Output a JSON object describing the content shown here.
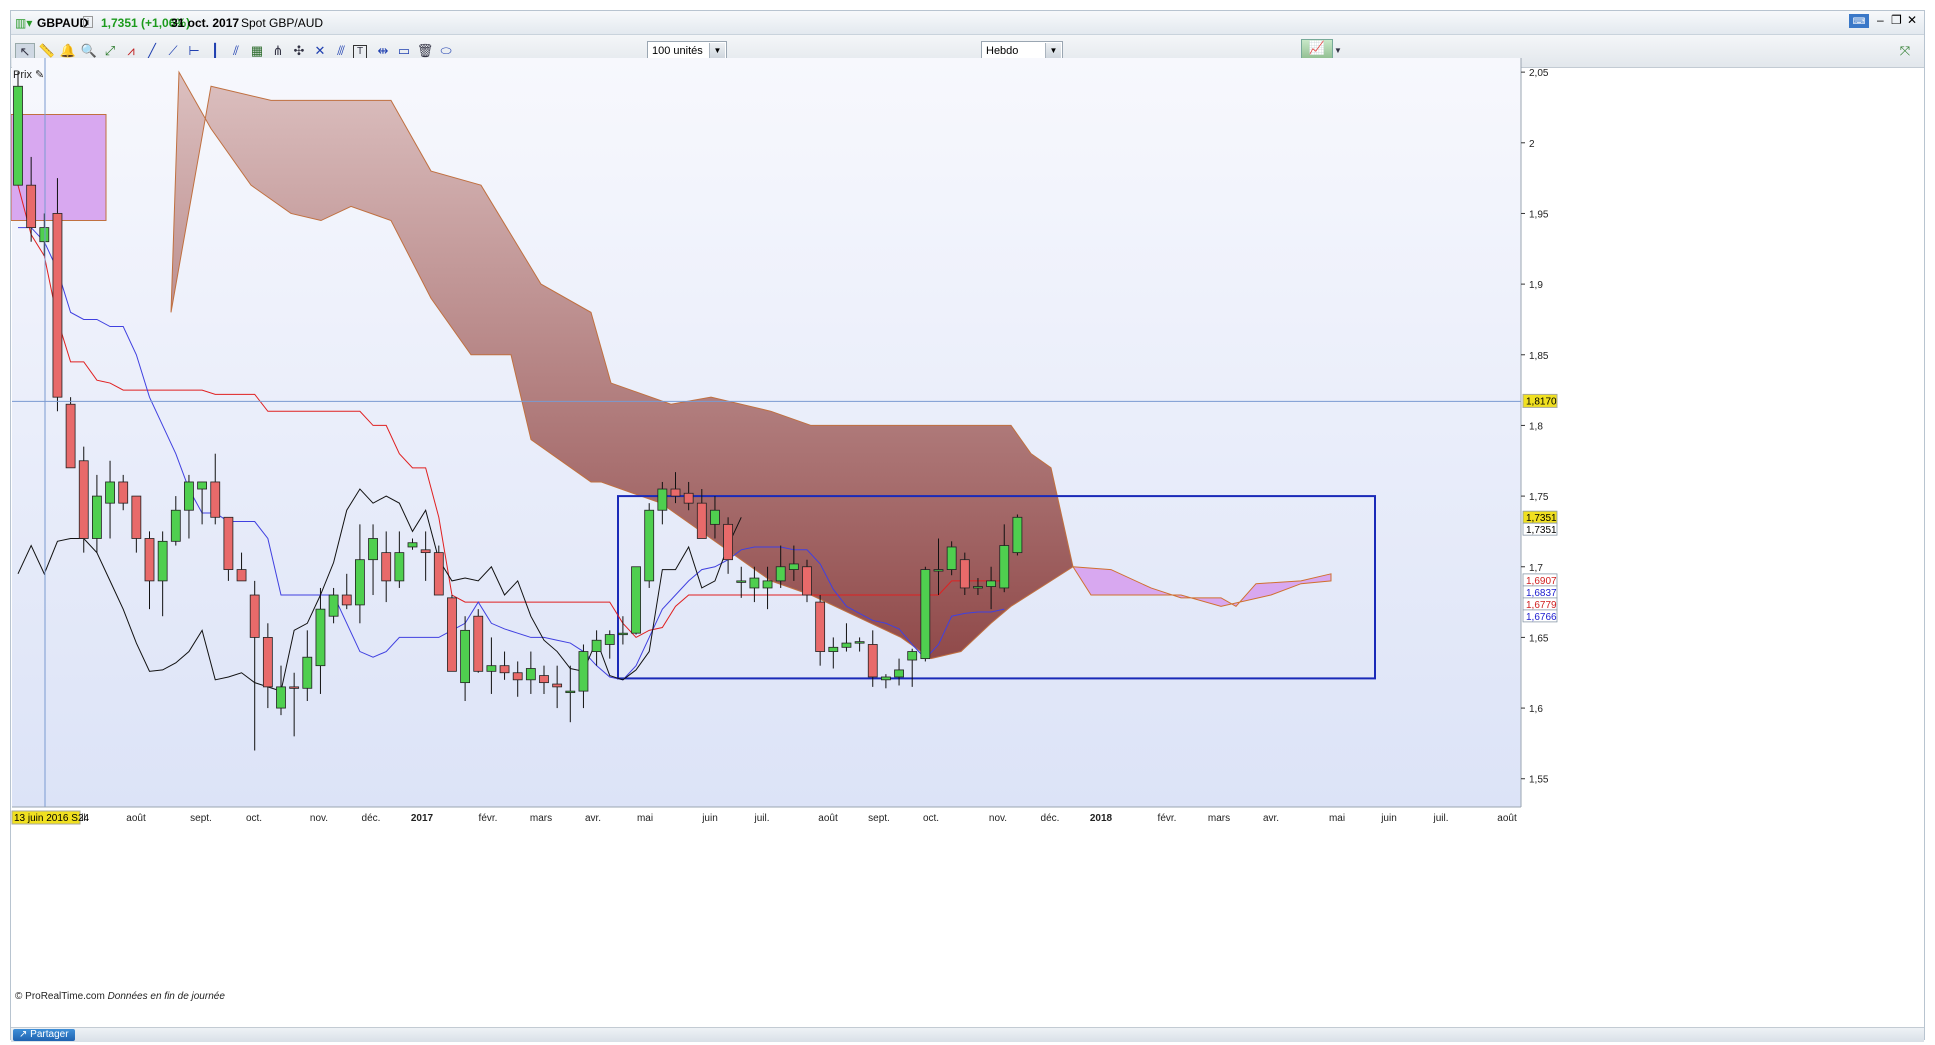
{
  "header": {
    "symbol": "GBPAUD",
    "quote": "1,7351 (+1,06%)",
    "date": "31 oct. 2017",
    "instrument": "Spot GBP/AUD"
  },
  "toolbar": {
    "units_select": "100 unités",
    "period_select": "Hebdo"
  },
  "chart_labels": {
    "price_label": "Prix",
    "copyright": "© ProRealTime.com",
    "data_note": "Données en fin de journée",
    "crosshair_date": "13 juin 2016 S24",
    "crosshair_price": "1,8170",
    "share_button": "Partager"
  },
  "colors": {
    "bull_candle": "#4fcf4f",
    "bear_candle": "#e86a6a",
    "kijun": "#e02020",
    "tenkan": "#4040e0",
    "chikou": "#111111",
    "cloud_bear": "#9a5a5a",
    "cloud_bull": "#d8a8f0",
    "box": "#1a2ab8"
  },
  "chart_data": {
    "type": "candlestick",
    "title": "GBPAUD hebdo",
    "ylim": [
      1.53,
      2.06
    ],
    "y_ticks": [
      "2,05",
      "2",
      "1,95",
      "1,9",
      "1,85",
      "1,8",
      "1,75",
      "1,7",
      "1,65",
      "1,6",
      "1,55"
    ],
    "y_tick_values": [
      2.05,
      2.0,
      1.95,
      1.9,
      1.85,
      1.8,
      1.75,
      1.7,
      1.65,
      1.6,
      1.55
    ],
    "x_labels": [
      "juil.",
      "août",
      "sept.",
      "oct.",
      "nov.",
      "déc.",
      "2017",
      "févr.",
      "mars",
      "avr.",
      "mai",
      "juin",
      "juil.",
      "août",
      "sept.",
      "oct.",
      "nov.",
      "déc.",
      "2018",
      "févr.",
      "mars",
      "avr.",
      "mai",
      "juin",
      "juil.",
      "août"
    ],
    "price_badges": [
      {
        "value": "1,7351",
        "color": "#f0e020"
      },
      {
        "value": "1,7351",
        "color": "#ffffff"
      },
      {
        "value": "1,6907",
        "color": "#ffffff"
      },
      {
        "value": "1,6837",
        "color": "#ffffff"
      },
      {
        "value": "1,6779",
        "color": "#ffffff"
      },
      {
        "value": "1,6766",
        "color": "#ffffff"
      }
    ],
    "candles": [
      {
        "o": 1.97,
        "h": 2.05,
        "l": 1.97,
        "c": 2.04
      },
      {
        "o": 1.97,
        "h": 1.99,
        "l": 1.93,
        "c": 1.94
      },
      {
        "o": 1.93,
        "h": 1.95,
        "l": 1.92,
        "c": 1.94
      },
      {
        "o": 1.95,
        "h": 1.975,
        "l": 1.81,
        "c": 1.82
      },
      {
        "o": 1.815,
        "h": 1.82,
        "l": 1.77,
        "c": 1.77
      },
      {
        "o": 1.775,
        "h": 1.785,
        "l": 1.71,
        "c": 1.72
      },
      {
        "o": 1.72,
        "h": 1.765,
        "l": 1.71,
        "c": 1.75
      },
      {
        "o": 1.745,
        "h": 1.775,
        "l": 1.72,
        "c": 1.76
      },
      {
        "o": 1.76,
        "h": 1.765,
        "l": 1.74,
        "c": 1.745
      },
      {
        "o": 1.75,
        "h": 1.75,
        "l": 1.71,
        "c": 1.72
      },
      {
        "o": 1.72,
        "h": 1.725,
        "l": 1.67,
        "c": 1.69
      },
      {
        "o": 1.69,
        "h": 1.725,
        "l": 1.665,
        "c": 1.718
      },
      {
        "o": 1.718,
        "h": 1.75,
        "l": 1.715,
        "c": 1.74
      },
      {
        "o": 1.74,
        "h": 1.765,
        "l": 1.72,
        "c": 1.76
      },
      {
        "o": 1.755,
        "h": 1.76,
        "l": 1.73,
        "c": 1.76
      },
      {
        "o": 1.76,
        "h": 1.78,
        "l": 1.73,
        "c": 1.735
      },
      {
        "o": 1.735,
        "h": 1.735,
        "l": 1.69,
        "c": 1.698
      },
      {
        "o": 1.698,
        "h": 1.71,
        "l": 1.69,
        "c": 1.69
      },
      {
        "o": 1.68,
        "h": 1.69,
        "l": 1.57,
        "c": 1.65
      },
      {
        "o": 1.65,
        "h": 1.66,
        "l": 1.6,
        "c": 1.615
      },
      {
        "o": 1.6,
        "h": 1.63,
        "l": 1.595,
        "c": 1.615
      },
      {
        "o": 1.615,
        "h": 1.625,
        "l": 1.58,
        "c": 1.614
      },
      {
        "o": 1.614,
        "h": 1.655,
        "l": 1.605,
        "c": 1.636
      },
      {
        "o": 1.63,
        "h": 1.685,
        "l": 1.61,
        "c": 1.67
      },
      {
        "o": 1.665,
        "h": 1.685,
        "l": 1.66,
        "c": 1.68
      },
      {
        "o": 1.68,
        "h": 1.695,
        "l": 1.67,
        "c": 1.673
      },
      {
        "o": 1.673,
        "h": 1.73,
        "l": 1.66,
        "c": 1.705
      },
      {
        "o": 1.705,
        "h": 1.73,
        "l": 1.68,
        "c": 1.72
      },
      {
        "o": 1.71,
        "h": 1.725,
        "l": 1.675,
        "c": 1.69
      },
      {
        "o": 1.69,
        "h": 1.725,
        "l": 1.685,
        "c": 1.71
      },
      {
        "o": 1.714,
        "h": 1.72,
        "l": 1.712,
        "c": 1.717
      },
      {
        "o": 1.712,
        "h": 1.725,
        "l": 1.69,
        "c": 1.71
      },
      {
        "o": 1.71,
        "h": 1.715,
        "l": 1.68,
        "c": 1.68
      },
      {
        "o": 1.678,
        "h": 1.68,
        "l": 1.63,
        "c": 1.626
      },
      {
        "o": 1.618,
        "h": 1.665,
        "l": 1.605,
        "c": 1.655
      },
      {
        "o": 1.665,
        "h": 1.67,
        "l": 1.625,
        "c": 1.626
      },
      {
        "o": 1.626,
        "h": 1.65,
        "l": 1.61,
        "c": 1.63
      },
      {
        "o": 1.63,
        "h": 1.64,
        "l": 1.62,
        "c": 1.625
      },
      {
        "o": 1.625,
        "h": 1.633,
        "l": 1.608,
        "c": 1.62
      },
      {
        "o": 1.62,
        "h": 1.64,
        "l": 1.61,
        "c": 1.628
      },
      {
        "o": 1.623,
        "h": 1.63,
        "l": 1.61,
        "c": 1.618
      },
      {
        "o": 1.617,
        "h": 1.63,
        "l": 1.6,
        "c": 1.615
      },
      {
        "o": 1.612,
        "h": 1.63,
        "l": 1.59,
        "c": 1.612
      },
      {
        "o": 1.612,
        "h": 1.645,
        "l": 1.6,
        "c": 1.64
      },
      {
        "o": 1.64,
        "h": 1.655,
        "l": 1.63,
        "c": 1.648
      },
      {
        "o": 1.645,
        "h": 1.655,
        "l": 1.635,
        "c": 1.652
      },
      {
        "o": 1.652,
        "h": 1.665,
        "l": 1.645,
        "c": 1.653
      },
      {
        "o": 1.653,
        "h": 1.7,
        "l": 1.652,
        "c": 1.7
      },
      {
        "o": 1.69,
        "h": 1.745,
        "l": 1.685,
        "c": 1.74
      },
      {
        "o": 1.74,
        "h": 1.76,
        "l": 1.73,
        "c": 1.755
      },
      {
        "o": 1.755,
        "h": 1.767,
        "l": 1.745,
        "c": 1.75
      },
      {
        "o": 1.752,
        "h": 1.76,
        "l": 1.74,
        "c": 1.745
      },
      {
        "o": 1.745,
        "h": 1.755,
        "l": 1.72,
        "c": 1.72
      },
      {
        "o": 1.73,
        "h": 1.75,
        "l": 1.72,
        "c": 1.74
      },
      {
        "o": 1.73,
        "h": 1.735,
        "l": 1.695,
        "c": 1.705
      },
      {
        "o": 1.69,
        "h": 1.7,
        "l": 1.678,
        "c": 1.69
      },
      {
        "o": 1.685,
        "h": 1.7,
        "l": 1.675,
        "c": 1.692
      },
      {
        "o": 1.685,
        "h": 1.7,
        "l": 1.67,
        "c": 1.69
      },
      {
        "o": 1.69,
        "h": 1.715,
        "l": 1.685,
        "c": 1.7
      },
      {
        "o": 1.698,
        "h": 1.715,
        "l": 1.69,
        "c": 1.702
      },
      {
        "o": 1.7,
        "h": 1.705,
        "l": 1.675,
        "c": 1.68
      },
      {
        "o": 1.675,
        "h": 1.68,
        "l": 1.63,
        "c": 1.64
      },
      {
        "o": 1.64,
        "h": 1.65,
        "l": 1.628,
        "c": 1.643
      },
      {
        "o": 1.643,
        "h": 1.66,
        "l": 1.64,
        "c": 1.646
      },
      {
        "o": 1.646,
        "h": 1.65,
        "l": 1.64,
        "c": 1.647
      },
      {
        "o": 1.645,
        "h": 1.655,
        "l": 1.615,
        "c": 1.622
      },
      {
        "o": 1.62,
        "h": 1.624,
        "l": 1.614,
        "c": 1.622
      },
      {
        "o": 1.622,
        "h": 1.635,
        "l": 1.616,
        "c": 1.627
      },
      {
        "o": 1.634,
        "h": 1.642,
        "l": 1.615,
        "c": 1.64
      },
      {
        "o": 1.635,
        "h": 1.7,
        "l": 1.633,
        "c": 1.698
      },
      {
        "o": 1.698,
        "h": 1.72,
        "l": 1.68,
        "c": 1.698
      },
      {
        "o": 1.698,
        "h": 1.718,
        "l": 1.694,
        "c": 1.714
      },
      {
        "o": 1.705,
        "h": 1.71,
        "l": 1.68,
        "c": 1.685
      },
      {
        "o": 1.685,
        "h": 1.692,
        "l": 1.68,
        "c": 1.686
      },
      {
        "o": 1.686,
        "h": 1.7,
        "l": 1.67,
        "c": 1.69
      },
      {
        "o": 1.685,
        "h": 1.73,
        "l": 1.682,
        "c": 1.715
      },
      {
        "o": 1.71,
        "h": 1.737,
        "l": 1.708,
        "c": 1.735
      }
    ],
    "kijun": [
      1.97,
      1.935,
      1.92,
      1.875,
      1.845,
      1.845,
      1.832,
      1.83,
      1.825,
      1.825,
      1.825,
      1.825,
      1.825,
      1.825,
      1.825,
      1.822,
      1.822,
      1.822,
      1.822,
      1.81,
      1.81,
      1.81,
      1.81,
      1.81,
      1.81,
      1.81,
      1.81,
      1.8,
      1.8,
      1.78,
      1.77,
      1.77,
      1.735,
      1.68,
      1.675,
      1.675,
      1.675,
      1.675,
      1.675,
      1.675,
      1.675,
      1.675,
      1.675,
      1.675,
      1.675,
      1.675,
      1.66,
      1.65,
      1.655,
      1.657,
      1.672,
      1.68,
      1.68,
      1.68,
      1.68,
      1.68,
      1.68,
      1.68,
      1.68,
      1.68,
      1.68,
      1.68,
      1.68,
      1.68,
      1.68,
      1.68,
      1.68,
      1.68,
      1.68,
      1.68,
      1.68,
      1.69,
      1.69,
      1.69,
      1.69,
      1.69
    ],
    "tenkan": [
      1.94,
      1.94,
      1.93,
      1.91,
      1.88,
      1.875,
      1.875,
      1.87,
      1.87,
      1.85,
      1.82,
      1.8,
      1.78,
      1.755,
      1.738,
      1.738,
      1.732,
      1.732,
      1.732,
      1.72,
      1.68,
      1.68,
      1.68,
      1.68,
      1.68,
      1.66,
      1.64,
      1.636,
      1.64,
      1.65,
      1.65,
      1.65,
      1.65,
      1.655,
      1.66,
      1.675,
      1.66,
      1.656,
      1.653,
      1.65,
      1.65,
      1.648,
      1.646,
      1.64,
      1.63,
      1.622,
      1.62,
      1.63,
      1.65,
      1.67,
      1.68,
      1.69,
      1.698,
      1.7,
      1.705,
      1.712,
      1.714,
      1.714,
      1.714,
      1.712,
      1.712,
      1.702,
      1.684,
      1.672,
      1.667,
      1.662,
      1.66,
      1.656,
      1.645,
      1.635,
      1.645,
      1.665,
      1.667,
      1.668,
      1.668,
      1.67
    ],
    "chikou": [
      1.695,
      1.715,
      1.695,
      1.718,
      1.72,
      1.72,
      1.71,
      1.69,
      1.67,
      1.646,
      1.626,
      1.627,
      1.632,
      1.64,
      1.655,
      1.62,
      1.622,
      1.625,
      1.618,
      1.615,
      1.612,
      1.655,
      1.66,
      1.68,
      1.703,
      1.74,
      1.755,
      1.745,
      1.75,
      1.745,
      1.725,
      1.74,
      1.705,
      1.69,
      1.692,
      1.69,
      1.7,
      1.68,
      1.69,
      1.665,
      1.648,
      1.64,
      1.628,
      1.626,
      1.648,
      1.623,
      1.62,
      1.627,
      1.64,
      1.698,
      1.698,
      1.714,
      1.685,
      1.69,
      1.715,
      1.735
    ]
  }
}
